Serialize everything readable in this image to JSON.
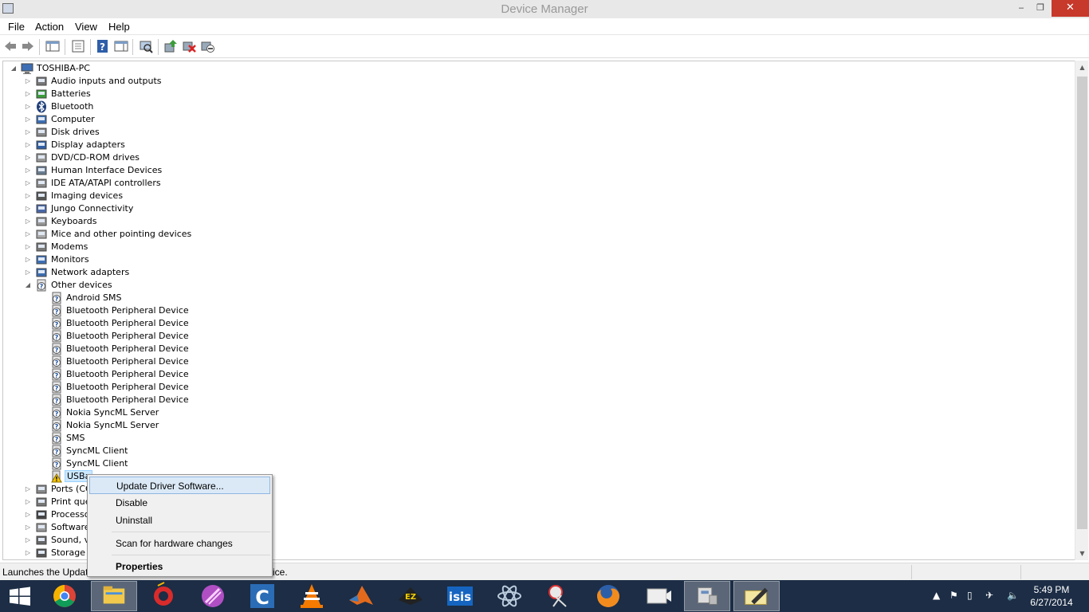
{
  "window": {
    "title": "Device Manager",
    "minimize_glyph": "‒",
    "maximize_glyph": "❐",
    "close_glyph": "✕"
  },
  "menu": [
    "File",
    "Action",
    "View",
    "Help"
  ],
  "toolbar_icons": [
    "back-icon",
    "forward-icon",
    "show-hide-console-tree-icon",
    "properties-icon",
    "help-icon",
    "show-action-pane-icon",
    "scan-hardware-changes-icon",
    "update-driver-icon",
    "uninstall-icon",
    "disable-icon"
  ],
  "tree": {
    "root": "TOSHIBA-PC",
    "categories": [
      {
        "label": "Audio inputs and outputs",
        "icon": "speaker-icon"
      },
      {
        "label": "Batteries",
        "icon": "battery-icon"
      },
      {
        "label": "Bluetooth",
        "icon": "bluetooth-icon"
      },
      {
        "label": "Computer",
        "icon": "computer-icon"
      },
      {
        "label": "Disk drives",
        "icon": "disk-drive-icon"
      },
      {
        "label": "Display adapters",
        "icon": "display-adapter-icon"
      },
      {
        "label": "DVD/CD-ROM drives",
        "icon": "dvd-drive-icon"
      },
      {
        "label": "Human Interface Devices",
        "icon": "hid-icon"
      },
      {
        "label": "IDE ATA/ATAPI controllers",
        "icon": "ide-controller-icon"
      },
      {
        "label": "Imaging devices",
        "icon": "camera-icon"
      },
      {
        "label": "Jungo Connectivity",
        "icon": "jungo-icon"
      },
      {
        "label": "Keyboards",
        "icon": "keyboard-icon"
      },
      {
        "label": "Mice and other pointing devices",
        "icon": "mouse-icon"
      },
      {
        "label": "Modems",
        "icon": "modem-icon"
      },
      {
        "label": "Monitors",
        "icon": "monitor-icon"
      },
      {
        "label": "Network adapters",
        "icon": "network-adapter-icon"
      },
      {
        "label": "Other devices",
        "icon": "unknown-device-icon",
        "expanded": true
      }
    ],
    "other_devices": [
      "Android SMS",
      "Bluetooth Peripheral Device",
      "Bluetooth Peripheral Device",
      "Bluetooth Peripheral Device",
      "Bluetooth Peripheral Device",
      "Bluetooth Peripheral Device",
      "Bluetooth Peripheral Device",
      "Bluetooth Peripheral Device",
      "Bluetooth Peripheral Device",
      "Nokia SyncML Server",
      "Nokia SyncML Server",
      "SMS",
      "SyncML Client",
      "SyncML Client"
    ],
    "selected_device": "USBa",
    "categories_after": [
      {
        "label": "Ports (CO",
        "icon": "port-icon"
      },
      {
        "label": "Print que",
        "icon": "printer-icon"
      },
      {
        "label": "Processo",
        "icon": "processor-icon"
      },
      {
        "label": "Software",
        "icon": "software-device-icon"
      },
      {
        "label": "Sound, v",
        "icon": "sound-icon"
      },
      {
        "label": "Storage c",
        "icon": "storage-controller-icon"
      }
    ]
  },
  "context_menu": {
    "update": "Update Driver Software...",
    "disable": "Disable",
    "uninstall": "Uninstall",
    "scan": "Scan for hardware changes",
    "properties": "Properties"
  },
  "status": {
    "left": "Launches the Update",
    "right": "ice."
  },
  "taskbar": {
    "apps": [
      "start-icon",
      "chrome-icon",
      "file-explorer-icon",
      "opera-icon",
      "app-icon",
      "ccleaner-icon",
      "vlc-icon",
      "matlab-icon",
      "ez-icon",
      "isis-icon",
      "atom-icon",
      "snipping-tool-icon",
      "firefox-icon",
      "camera-app-icon",
      "device-manager-icon",
      "editor-icon"
    ],
    "clock_time": "5:49 PM",
    "clock_date": "6/27/2014"
  },
  "colors": {
    "close_button": "#c7392b",
    "taskbar": "#1c2d45",
    "selection": "#cce8ff",
    "menu_highlight": "#dbe9f7"
  }
}
